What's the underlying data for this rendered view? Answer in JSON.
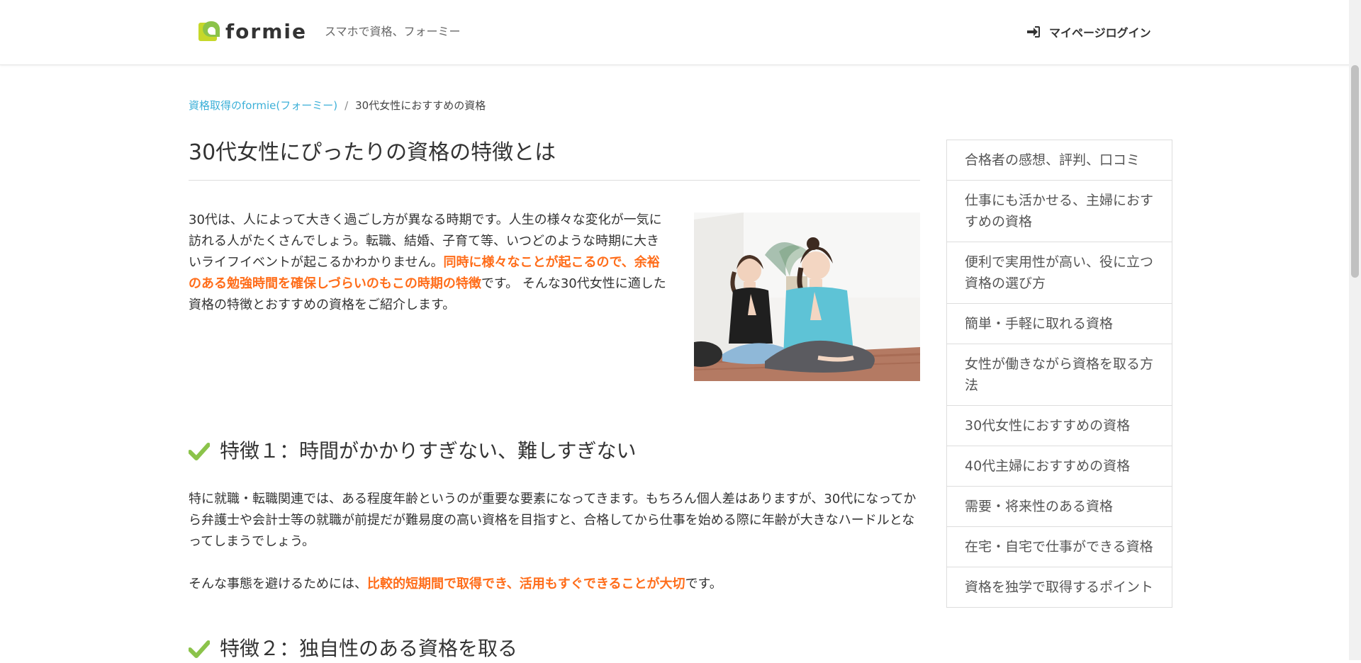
{
  "header": {
    "logo_text": "formie",
    "tagline": "スマホで資格、フォーミー",
    "login_label": "マイページログイン",
    "login_icon": "sign-in-icon"
  },
  "breadcrumb": {
    "home": "資格取得のformie(フォーミー)",
    "separator": "/",
    "current": "30代女性におすすめの資格"
  },
  "main": {
    "title": "30代女性にぴったりの資格の特徴とは",
    "intro": {
      "text1": "30代は、人によって大きく過ごし方が異なる時期です。人生の様々な変化が一気に訪れる人がたくさんでしょう。転職、結婚、子育て等、いつどのような時期に大きいライフイベントが起こるかわかりません。",
      "highlight": "同時に様々なことが起こるので、余裕のある勉強時間を確保しづらいのもこの時期の特徴",
      "text2": "です。 そんな30代女性に適した資格の特徴とおすすめの資格をご紹介します。"
    },
    "section1": {
      "heading": "特徴１：時間がかかりすぎない、難しすぎない",
      "para1": "特に就職・転職関連では、ある程度年齢というのが重要な要素になってきます。もちろん個人差はありますが、30代になってから弁護士や会計士等の就職が前提だが難易度の高い資格を目指すと、合格してから仕事を始める際に年齢が大きなハードルとなってしまうでしょう。",
      "para2_pre": "そんな事態を避けるためには、",
      "para2_highlight": "比較的短期間で取得でき、活用もすぐできることが大切",
      "para2_post": "です。"
    },
    "section2": {
      "heading": "特徴２：独自性のある資格を取る"
    }
  },
  "sidebar": {
    "items": [
      {
        "label": "合格者の感想、評判、口コミ"
      },
      {
        "label": "仕事にも活かせる、主婦におすすめの資格"
      },
      {
        "label": "便利で実用性が高い、役に立つ資格の選び方"
      },
      {
        "label": "簡単・手軽に取れる資格"
      },
      {
        "label": "女性が働きながら資格を取る方法"
      },
      {
        "label": "30代女性におすすめの資格"
      },
      {
        "label": "40代主婦におすすめの資格"
      },
      {
        "label": "需要・将来性のある資格"
      },
      {
        "label": "在宅・自宅で仕事ができる資格"
      },
      {
        "label": "資格を独学で取得するポイント"
      }
    ]
  },
  "colors": {
    "accent_orange": "#ff6d1a",
    "link_blue": "#3cb0d8",
    "check_green": "#8bc34a",
    "logo_lime": "#c6d82a"
  }
}
